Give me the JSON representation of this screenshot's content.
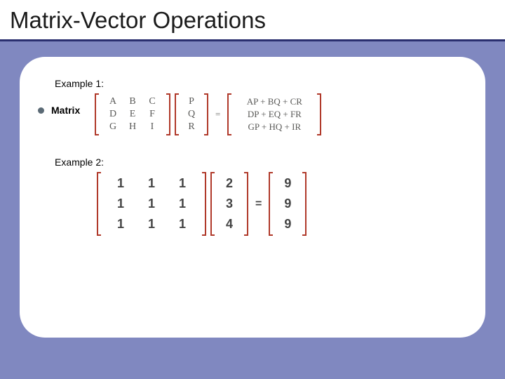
{
  "title": "Matrix-Vector Operations",
  "example1_label": "Example 1:",
  "bullet_label": "Matrix",
  "example2_label": "Example 2:",
  "ex1": {
    "matrix": [
      [
        "A",
        "B",
        "C"
      ],
      [
        "D",
        "E",
        "F"
      ],
      [
        "G",
        "H",
        "I"
      ]
    ],
    "vector": [
      "P",
      "Q",
      "R"
    ],
    "result": [
      "AP + BQ + CR",
      "DP + EQ + FR",
      "GP + HQ + IR"
    ]
  },
  "ex2": {
    "matrix": [
      [
        "1",
        "1",
        "1"
      ],
      [
        "1",
        "1",
        "1"
      ],
      [
        "1",
        "1",
        "1"
      ]
    ],
    "vector": [
      "2",
      "3",
      "4"
    ],
    "result": [
      "9",
      "9",
      "9"
    ]
  },
  "equals": "="
}
